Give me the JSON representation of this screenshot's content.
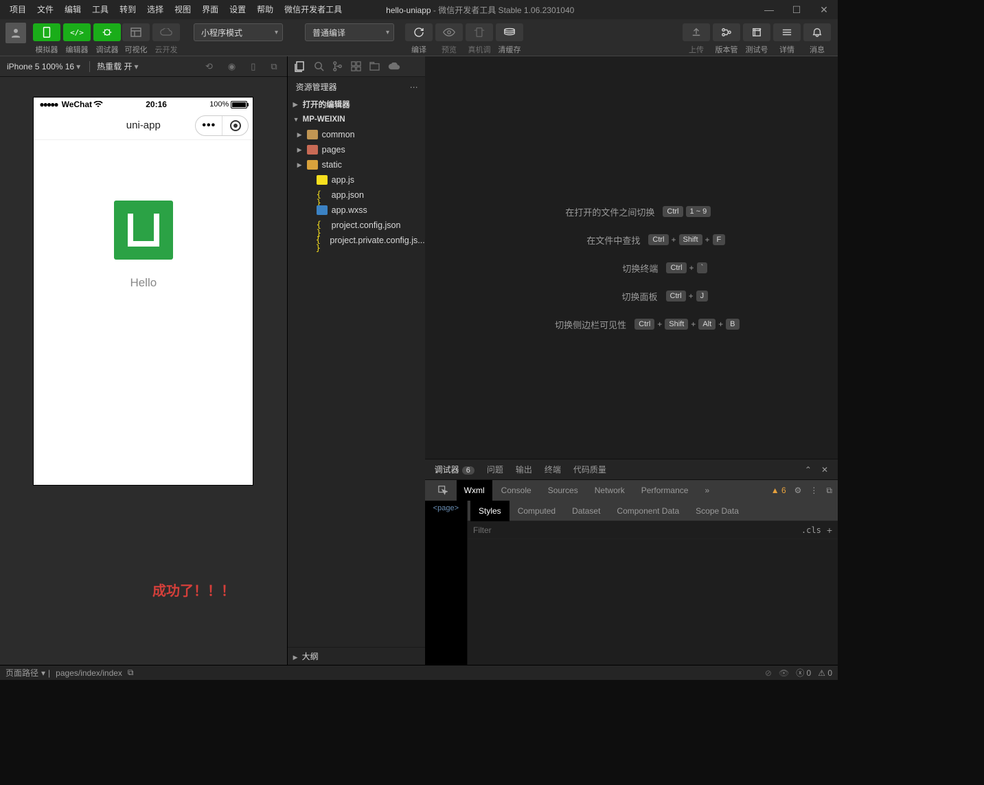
{
  "menubar": {
    "items": [
      "项目",
      "文件",
      "编辑",
      "工具",
      "转到",
      "选择",
      "视图",
      "界面",
      "设置",
      "帮助",
      "微信开发者工具"
    ],
    "title_app": "hello-uniapp",
    "title_rest": " - 微信开发者工具 Stable 1.06.2301040"
  },
  "toolbar": {
    "labels": {
      "simulator": "模拟器",
      "editor": "编辑器",
      "debugger": "调试器",
      "visual": "可视化",
      "cloud": "云开发",
      "compile": "编译",
      "preview": "预览",
      "remote": "真机调试",
      "clear": "清缓存",
      "upload": "上传",
      "version": "版本管理",
      "testno": "测试号",
      "detail": "详情",
      "message": "消息"
    },
    "mode": "小程序模式",
    "build": "普通编译"
  },
  "simulator": {
    "device": "iPhone 5 100% 16",
    "hotreload": "热重载 开",
    "status": {
      "carrier": "WeChat",
      "time": "20:16",
      "battery": "100%"
    },
    "nav_title": "uni-app",
    "hello": "Hello"
  },
  "success_text": "成功了！！！",
  "explorer": {
    "title": "资源管理器",
    "sections": {
      "opened": "打开的编辑器",
      "root": "MP-WEIXIN"
    },
    "tree": [
      {
        "name": "common",
        "kind": "folder",
        "color": "folder"
      },
      {
        "name": "pages",
        "kind": "folder",
        "color": "folder-r"
      },
      {
        "name": "static",
        "kind": "folder",
        "color": "folder-o"
      },
      {
        "name": "app.js",
        "kind": "file",
        "color": "js"
      },
      {
        "name": "app.json",
        "kind": "file",
        "color": "json"
      },
      {
        "name": "app.wxss",
        "kind": "file",
        "color": "wxss"
      },
      {
        "name": "project.config.json",
        "kind": "file",
        "color": "json"
      },
      {
        "name": "project.private.config.js...",
        "kind": "file",
        "color": "json"
      }
    ],
    "outline": "大纲"
  },
  "welcome_shortcuts": [
    {
      "label": "在打开的文件之间切换",
      "keys": [
        "Ctrl",
        "1 ~ 9"
      ]
    },
    {
      "label": "在文件中查找",
      "keys": [
        "Ctrl",
        "+",
        "Shift",
        "+",
        "F"
      ]
    },
    {
      "label": "切换终端",
      "keys": [
        "Ctrl",
        "+",
        "`"
      ]
    },
    {
      "label": "切换面板",
      "keys": [
        "Ctrl",
        "+",
        "J"
      ]
    },
    {
      "label": "切换侧边栏可见性",
      "keys": [
        "Ctrl",
        "+",
        "Shift",
        "+",
        "Alt",
        "+",
        "B"
      ]
    }
  ],
  "debugger": {
    "tabs": [
      "调试器",
      "问题",
      "输出",
      "终端",
      "代码质量"
    ],
    "debug_badge": "6",
    "devtools": [
      "Wxml",
      "Console",
      "Sources",
      "Network",
      "Performance"
    ],
    "warn_count": "6",
    "wxml_text": "<page>",
    "style_tabs": [
      "Styles",
      "Computed",
      "Dataset",
      "Component Data",
      "Scope Data"
    ],
    "filter": "Filter",
    "cls": ".cls"
  },
  "statusbar": {
    "route_label": "页面路径",
    "route": "pages/index/index",
    "err": "0",
    "warn": "0"
  }
}
